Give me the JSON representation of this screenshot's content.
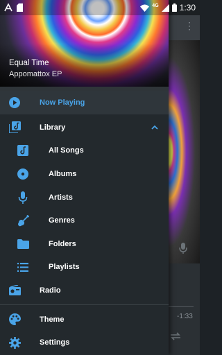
{
  "status_bar": {
    "time": "1:30",
    "network": "4G",
    "icons": [
      "a-notification-icon",
      "sd-card-icon",
      "wifi-icon",
      "signal-icon",
      "battery-icon"
    ]
  },
  "header": {
    "track_title": "Equal Time",
    "album": "Appomattox EP"
  },
  "menu": {
    "now_playing": "Now Playing",
    "library": "Library",
    "library_items": {
      "all_songs": "All Songs",
      "albums": "Albums",
      "artists": "Artists",
      "genres": "Genres",
      "folders": "Folders",
      "playlists": "Playlists"
    },
    "radio": "Radio",
    "theme": "Theme",
    "settings": "Settings"
  },
  "background": {
    "elapsed_time": "-1:33"
  },
  "colors": {
    "accent": "#4aa4e8",
    "drawer_bg": "#23292d"
  }
}
